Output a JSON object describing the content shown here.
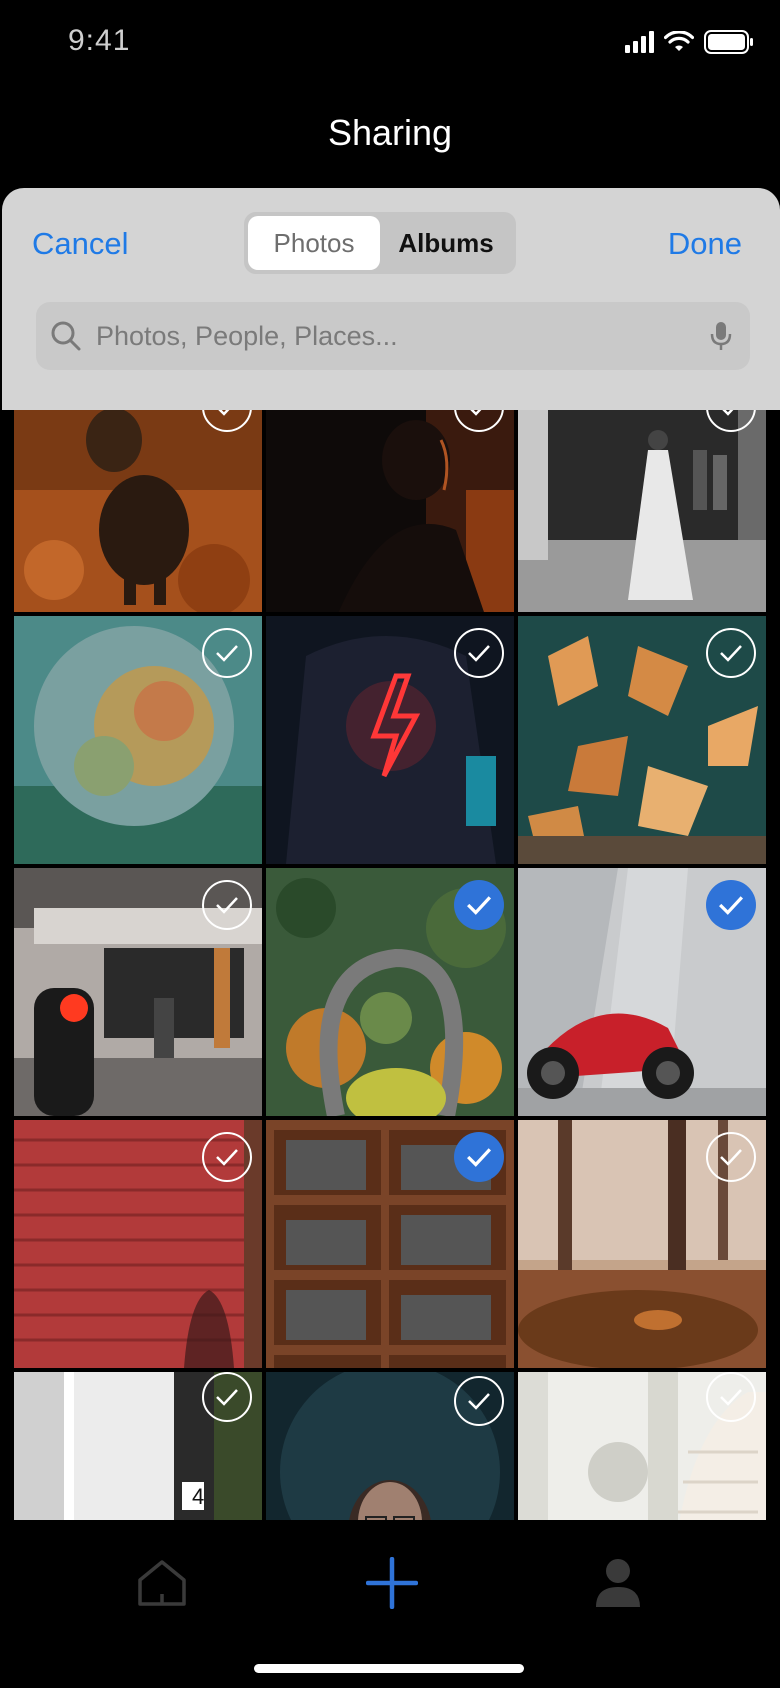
{
  "status_bar": {
    "time": "9:41"
  },
  "header": {
    "title": "Sharing"
  },
  "sheet": {
    "cancel_label": "Cancel",
    "done_label": "Done",
    "segments": [
      "Photos",
      "Albums"
    ],
    "active_segment": "Photos",
    "search": {
      "placeholder": "Photos, People, Places...",
      "value": ""
    }
  },
  "grid": {
    "photos": [
      {
        "subject": "dachshund in autumn leaves",
        "selected": false
      },
      {
        "subject": "silhouette in dark",
        "selected": false
      },
      {
        "subject": "bride black and white",
        "selected": false
      },
      {
        "subject": "blurred globe",
        "selected": false
      },
      {
        "subject": "neon lightning bolt",
        "selected": false
      },
      {
        "subject": "orange leaves on teal",
        "selected": false
      },
      {
        "subject": "street traffic light",
        "selected": false
      },
      {
        "subject": "aerial forest road",
        "selected": true
      },
      {
        "subject": "red motorcycle",
        "selected": true
      },
      {
        "subject": "red shutter shadow",
        "selected": false
      },
      {
        "subject": "wooden shelves",
        "selected": true
      },
      {
        "subject": "misty autumn forest",
        "selected": false
      },
      {
        "subject": "white curtains window",
        "selected": false
      },
      {
        "subject": "portrait man with glasses",
        "selected": false
      },
      {
        "subject": "white knit blanket",
        "selected": false
      }
    ]
  },
  "tab_bar": {
    "items": [
      "home-icon",
      "add-icon",
      "profile-icon"
    ],
    "accent": "#2f73d8"
  },
  "colors": {
    "accent": "#1f7ae6",
    "selected_check": "#2f73d8"
  }
}
